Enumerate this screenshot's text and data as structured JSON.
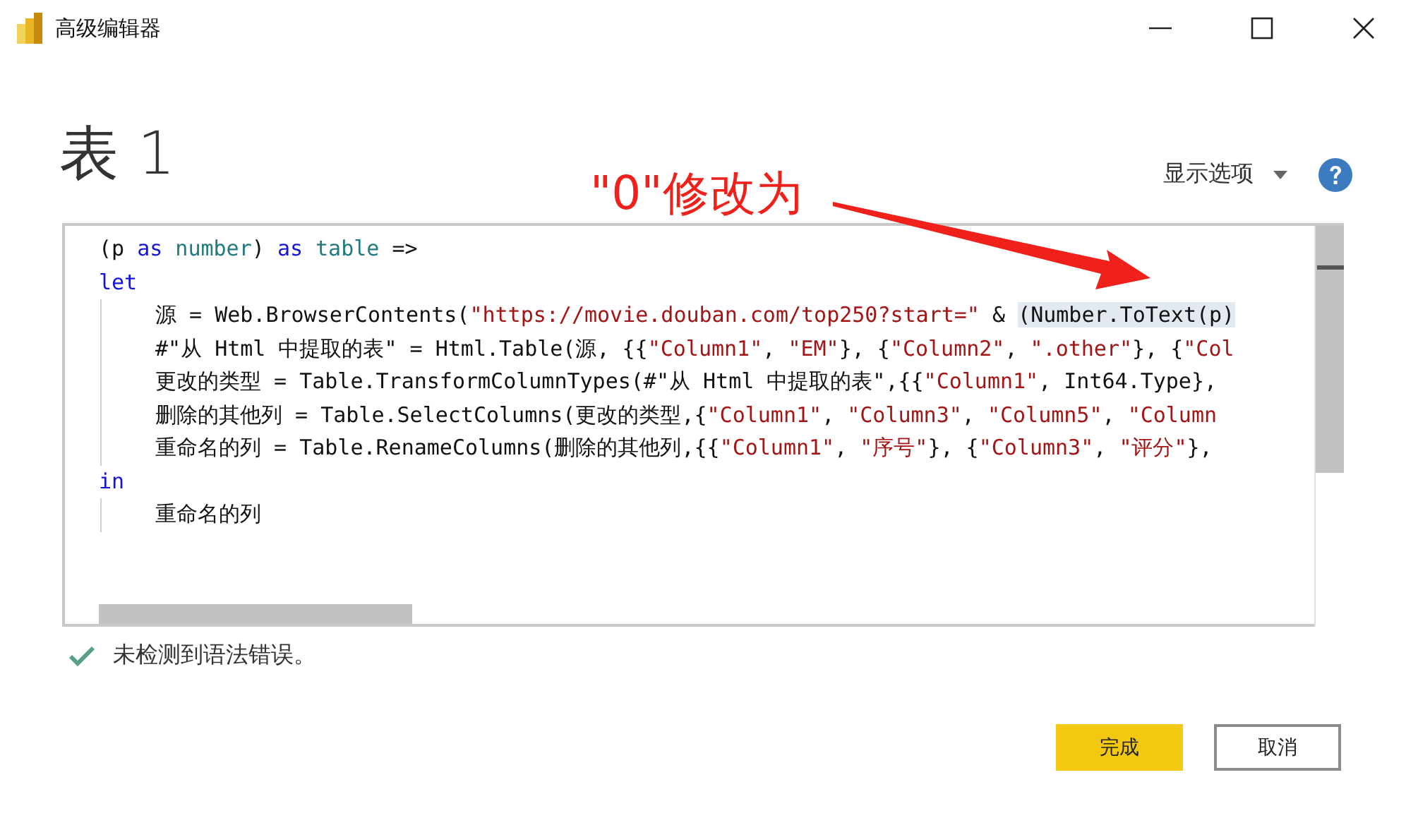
{
  "window": {
    "title": "高级编辑器"
  },
  "heading": "表 1",
  "display_options": {
    "label": "显示选项"
  },
  "annotation": {
    "text": "\"0\"修改为"
  },
  "editor": {
    "lines": [
      {
        "tokens": [
          {
            "text": "(p ",
            "kind": "plain"
          },
          {
            "text": "as",
            "kind": "keyword"
          },
          {
            "text": " number",
            "kind": "type"
          },
          {
            "text": ") ",
            "kind": "plain"
          },
          {
            "text": "as",
            "kind": "keyword"
          },
          {
            "text": " table",
            "kind": "type"
          },
          {
            "text": " =>",
            "kind": "plain"
          }
        ]
      },
      {
        "tokens": [
          {
            "text": "let",
            "kind": "keyword"
          }
        ],
        "children": [
          {
            "tokens": [
              {
                "text": "源 = Web.BrowserContents(",
                "kind": "plain"
              },
              {
                "text": "\"https://movie.douban.com/top250?start=\"",
                "kind": "string"
              },
              {
                "text": " & ",
                "kind": "plain"
              },
              {
                "text": "(Number.ToText(p)",
                "kind": "plain",
                "highlighted": true
              }
            ]
          },
          {
            "tokens": [
              {
                "text": "#\"从 Html 中提取的表\" = Html.Table(源, {{",
                "kind": "plain"
              },
              {
                "text": "\"Column1\"",
                "kind": "string"
              },
              {
                "text": ", ",
                "kind": "plain"
              },
              {
                "text": "\"EM\"",
                "kind": "string"
              },
              {
                "text": "}, {",
                "kind": "plain"
              },
              {
                "text": "\"Column2\"",
                "kind": "string"
              },
              {
                "text": ", ",
                "kind": "plain"
              },
              {
                "text": "\".other\"",
                "kind": "string"
              },
              {
                "text": "}, {",
                "kind": "plain"
              },
              {
                "text": "\"Col",
                "kind": "string"
              }
            ]
          },
          {
            "tokens": [
              {
                "text": "更改的类型 = Table.TransformColumnTypes(#\"从 Html 中提取的表\",{{",
                "kind": "plain"
              },
              {
                "text": "\"Column1\"",
                "kind": "string"
              },
              {
                "text": ", Int64.Type},",
                "kind": "plain"
              }
            ]
          },
          {
            "tokens": [
              {
                "text": "删除的其他列 = Table.SelectColumns(更改的类型,{",
                "kind": "plain"
              },
              {
                "text": "\"Column1\"",
                "kind": "string"
              },
              {
                "text": ", ",
                "kind": "plain"
              },
              {
                "text": "\"Column3\"",
                "kind": "string"
              },
              {
                "text": ", ",
                "kind": "plain"
              },
              {
                "text": "\"Column5\"",
                "kind": "string"
              },
              {
                "text": ", ",
                "kind": "plain"
              },
              {
                "text": "\"Column",
                "kind": "string"
              }
            ]
          },
          {
            "tokens": [
              {
                "text": "重命名的列 = Table.RenameColumns(删除的其他列,{{",
                "kind": "plain"
              },
              {
                "text": "\"Column1\"",
                "kind": "string"
              },
              {
                "text": ", ",
                "kind": "plain"
              },
              {
                "text": "\"序号\"",
                "kind": "string"
              },
              {
                "text": "}, {",
                "kind": "plain"
              },
              {
                "text": "\"Column3\"",
                "kind": "string"
              },
              {
                "text": ", ",
                "kind": "plain"
              },
              {
                "text": "\"评分\"",
                "kind": "string"
              },
              {
                "text": "},",
                "kind": "plain"
              }
            ]
          }
        ]
      },
      {
        "tokens": [
          {
            "text": "in",
            "kind": "keyword"
          }
        ],
        "children": [
          {
            "tokens": [
              {
                "text": "重命名的列",
                "kind": "plain"
              }
            ]
          }
        ]
      }
    ]
  },
  "status": {
    "message": "未检测到语法错误。",
    "ok": true
  },
  "buttons": [
    {
      "label": "完成",
      "kind": "primary"
    },
    {
      "label": "取消",
      "kind": "secondary"
    }
  ]
}
